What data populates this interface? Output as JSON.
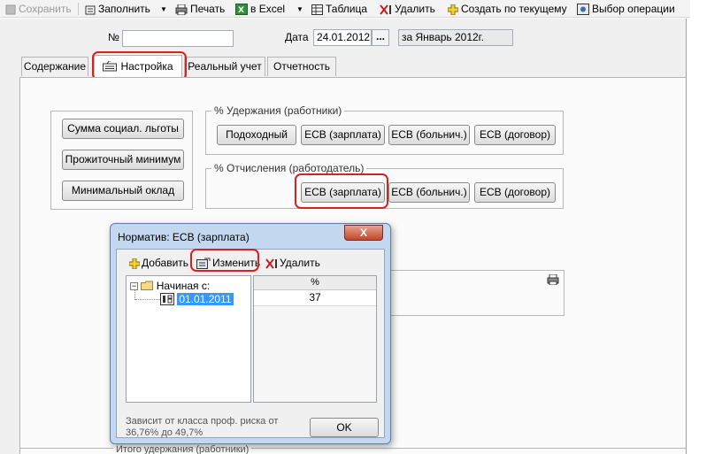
{
  "toolbar": {
    "save": "Сохранить",
    "fill": "Заполнить",
    "print": "Печать",
    "excel": "в Excel",
    "table": "Таблица",
    "delete": "Удалить",
    "create_from_current": "Создать по текущему",
    "choose_operation": "Выбор операции"
  },
  "header": {
    "number_label": "№",
    "number_value": "",
    "date_label": "Дата",
    "date_value": "24.01.2012",
    "date_button": "...",
    "period_text": "за Январь 2012г."
  },
  "tabs": [
    {
      "label": "Содержание",
      "active": false
    },
    {
      "label": "Настройка",
      "active": true
    },
    {
      "label": "Реальный учет",
      "active": false
    },
    {
      "label": "Отчетность",
      "active": false
    }
  ],
  "settings": {
    "left_buttons": [
      "Сумма социал. льготы",
      "Прожиточный минимум",
      "Минимальный оклад"
    ],
    "withholding_title": "% Удержания (работники)",
    "withholding_buttons": [
      "Подоходный",
      "ЕСВ (зарплата)",
      "ЕСВ (больнич.)",
      "ЕСВ (договор)"
    ],
    "contrib_title": "% Отчисления (работодатель)",
    "contrib_buttons": [
      "ЕСВ (зарплата)",
      "ЕСВ (больнич.)",
      "ЕСВ (договор)"
    ],
    "bottom_group_title": "Итого удержания (работники)"
  },
  "dialog": {
    "title": "Норматив: ЕСВ (зарплата)",
    "close": "X",
    "add": "Добавить",
    "edit": "Изменить",
    "delete": "Удалить",
    "tree_root": "Начиная с:",
    "tree_item": "01.01.2011",
    "grid_header": "%",
    "grid_value": "37",
    "note": "Зависит от класса проф. риска от 36,76% до 49,7%",
    "ok": "OK"
  },
  "colors": {
    "highlight_ring": "#d52222",
    "selection": "#3399ff",
    "dialog_frame": "#c3d8ee"
  }
}
